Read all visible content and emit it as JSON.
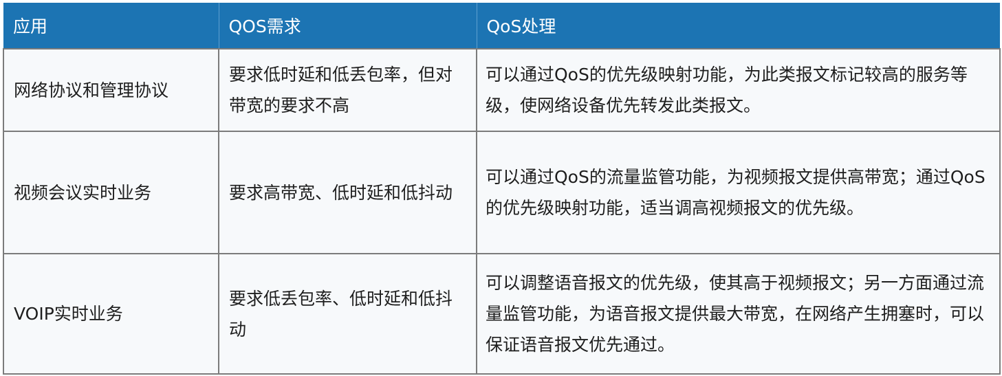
{
  "table": {
    "headers": [
      "应用",
      "QOS需求",
      "QoS处理"
    ],
    "rows": [
      {
        "application": "网络协议和管理协议",
        "requirement": "要求低时延和低丢包率，但对带宽的要求不高",
        "handling": "可以通过QoS的优先级映射功能，为此类报文标记较高的服务等级，使网络设备优先转发此类报文。"
      },
      {
        "application": "视频会议实时业务",
        "requirement": "要求高带宽、低时延和低抖动",
        "handling": "可以通过QoS的流量监管功能，为视频报文提供高带宽；通过QoS的优先级映射功能，适当调高视频报文的优先级。"
      },
      {
        "application": "VOIP实时业务",
        "requirement": "要求低丢包率、低时延和低抖动",
        "handling": "可以调整语音报文的优先级，使其高于视频报文；另一方面通过流量监管功能，为语音报文提供最大带宽，在网络产生拥塞时，可以保证语音报文优先通过。"
      }
    ]
  },
  "colors": {
    "header_background": "#1c74b3",
    "header_text": "#ffffff",
    "cell_background": "#f7f9fb",
    "border": "#7b7b7b"
  }
}
